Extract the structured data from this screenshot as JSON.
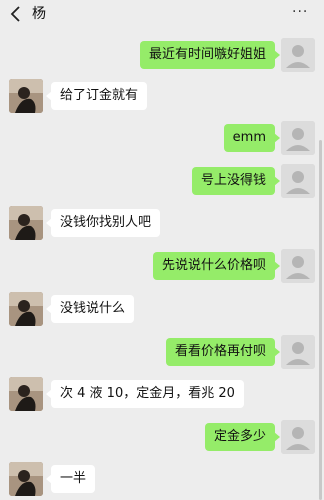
{
  "header": {
    "back_icon": "chevron-left-icon",
    "title": "杨",
    "more_icon": "more-dots-icon",
    "more_label": "···"
  },
  "colors": {
    "background": "#ededed",
    "outgoing_bubble": "#95ec69",
    "incoming_bubble": "#ffffff"
  },
  "messages": [
    {
      "side": "out",
      "text": "最近有时间嗾好姐姐"
    },
    {
      "side": "in",
      "text": "给了订金就有"
    },
    {
      "side": "out",
      "text": "emm"
    },
    {
      "side": "out",
      "text": "号上没得钱"
    },
    {
      "side": "in",
      "text": "没钱你找别人吧"
    },
    {
      "side": "out",
      "text": "先说说什么价格呗"
    },
    {
      "side": "in",
      "text": "没钱说什么"
    },
    {
      "side": "out",
      "text": "看看价格再付呗"
    },
    {
      "side": "in",
      "text": "次 4 液 10，定金月，看兆 20"
    },
    {
      "side": "out",
      "text": "定金多少"
    },
    {
      "side": "in",
      "text": "一半"
    }
  ]
}
